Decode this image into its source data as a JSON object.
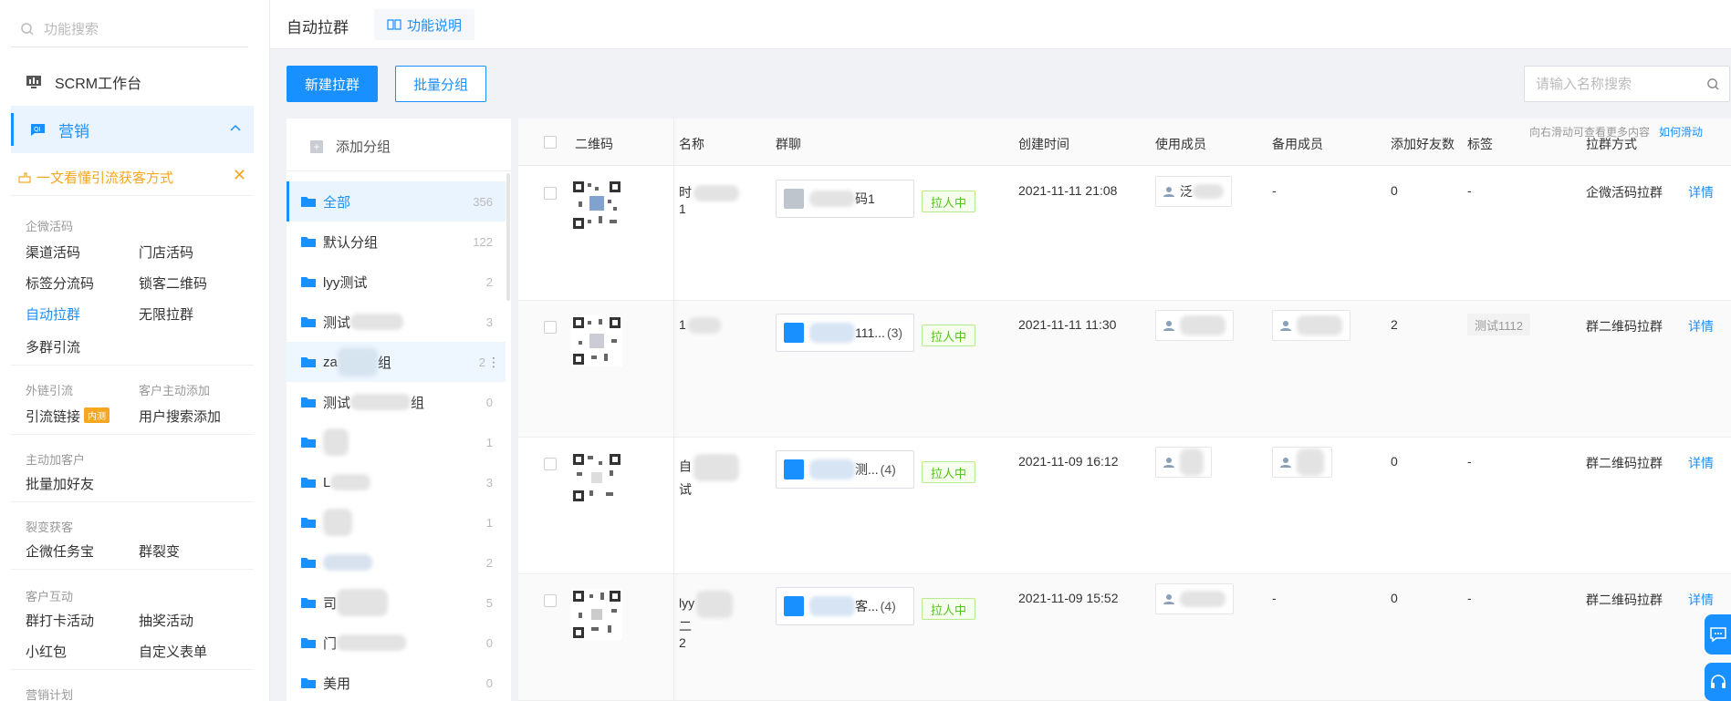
{
  "nav": {
    "search_placeholder": "功能搜索",
    "workbench": "SCRM工作台",
    "marketing": "营销",
    "tip": "一文看懂引流获客方式",
    "sections": [
      {
        "title": "企微活码",
        "links": [
          "渠道活码",
          "门店活码",
          "标签分流码",
          "锁客二维码",
          "自动拉群",
          "无限拉群",
          "多群引流"
        ]
      },
      {
        "title": "外链引流",
        "links": [
          "引流链接"
        ]
      },
      {
        "title": "客户主动添加",
        "links": [
          "用户搜索添加"
        ]
      },
      {
        "title": "主动加客户",
        "links": [
          "批量加好友"
        ]
      },
      {
        "title": "裂变获客",
        "links": [
          "企微任务宝",
          "群裂变"
        ]
      },
      {
        "title": "客户互动",
        "links": [
          "群打卡活动",
          "抽奖活动",
          "小红包",
          "自定义表单"
        ]
      },
      {
        "title": "营销计划",
        "links": []
      }
    ],
    "inner_badge": "内测"
  },
  "header": {
    "title": "自动拉群",
    "help": "功能说明"
  },
  "toolbar": {
    "new_button": "新建拉群",
    "batch_button": "批量分组",
    "search_placeholder": "请输入名称搜索"
  },
  "groups": {
    "add": "添加分组",
    "items": [
      {
        "name": "全部",
        "count": "356"
      },
      {
        "name": "默认分组",
        "count": "122"
      },
      {
        "name": "lyy测试",
        "count": "2"
      },
      {
        "name": "测试",
        "count": "3"
      },
      {
        "name": "za",
        "suffix": "组",
        "count": "2"
      },
      {
        "name": "测试",
        "suffix": "组",
        "count": "0"
      },
      {
        "name": "",
        "count": "1"
      },
      {
        "name": "L",
        "count": "3"
      },
      {
        "name": "",
        "count": "1"
      },
      {
        "name": "",
        "count": "2"
      },
      {
        "name": "司",
        "count": "5"
      },
      {
        "name": "门",
        "count": "0"
      },
      {
        "name": "美用",
        "count": "0"
      }
    ]
  },
  "table": {
    "scroll_hint": "向右滑动可查看更多内容",
    "scroll_hint_link": "如何滑动",
    "headers": [
      "二维码",
      "名称",
      "群聊",
      "创建时间",
      "使用成员",
      "备用成员",
      "添加好友数",
      "标签",
      "拉群方式"
    ],
    "rows": [
      {
        "name_lines": [
          "时",
          "1"
        ],
        "chat": "码1",
        "chat_count": "",
        "status": "拉人中",
        "created": "2021-11-11 21:08",
        "member": "泛",
        "backup": "-",
        "friends": "0",
        "tag": "-",
        "method": "企微活码拉群",
        "detail": "详情"
      },
      {
        "name_lines": [
          "1"
        ],
        "chat": "111...",
        "chat_count": "(3)",
        "status": "拉人中",
        "created": "2021-11-11 11:30",
        "member": "",
        "backup": "",
        "friends": "2",
        "tag": "测试1112",
        "method": "群二维码拉群",
        "detail": "详情"
      },
      {
        "name_lines": [
          "自",
          "试"
        ],
        "chat": "测...",
        "chat_count": "(4)",
        "status": "拉人中",
        "created": "2021-11-09 16:12",
        "member": "",
        "backup": "",
        "friends": "0",
        "tag": "-",
        "method": "群二维码拉群",
        "detail": "详情"
      },
      {
        "name_lines": [
          "lyy",
          "二",
          "2"
        ],
        "chat": "客...",
        "chat_count": "(4)",
        "status": "拉人中",
        "created": "2021-11-09 15:52",
        "member": "",
        "backup": "-",
        "friends": "0",
        "tag": "-",
        "method": "群二维码拉群",
        "detail": "详情"
      }
    ]
  },
  "colors": {
    "primary": "#1890ff",
    "status_green": "#52c41a",
    "tip_orange": "#f5a623"
  }
}
